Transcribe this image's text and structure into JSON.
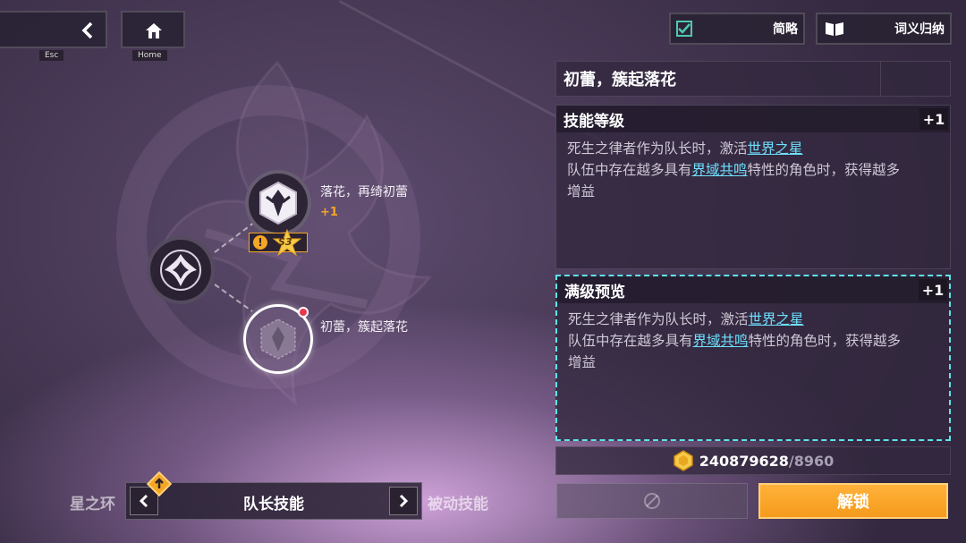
{
  "nav": {
    "esc_tag": "Esc",
    "home_tag": "Home"
  },
  "toggles": {
    "brief_label": "简略",
    "glossary_label": "词义归纳",
    "brief_checked": true
  },
  "skill_title": "初蕾，簇起落花",
  "nodes": [
    {
      "label": "落花，再绮初蕾",
      "bonus": "+1",
      "badge": "S3"
    },
    {
      "label": "初蕾，簇起落花"
    }
  ],
  "level_panel": {
    "heading": "技能等级",
    "level": "+1",
    "line1_pre": "死生之律者作为队长时，激活",
    "line1_link": "世界之星",
    "line2_pre": "队伍中存在越多具有",
    "line2_link": "界域共鸣",
    "line2_post": "特性的角色时，获得越多",
    "line3": "增益"
  },
  "max_panel": {
    "heading": "满级预览",
    "level": "+1",
    "line1_pre": "死生之律者作为队长时，激活",
    "line1_link": "世界之星",
    "line2_pre": "队伍中存在越多具有",
    "line2_link": "界域共鸣",
    "line2_post": "特性的角色时，获得越多",
    "line3": "增益"
  },
  "cost": {
    "owned": "240879628",
    "required": "/8960"
  },
  "unlock_label": "解锁",
  "bottom_tabs": {
    "left": "星之环",
    "current": "队长技能",
    "right": "被动技能"
  },
  "colors": {
    "accent_orange": "#f5a623",
    "link_cyan": "#6ee0ff",
    "check_green": "#4ec9b0"
  }
}
